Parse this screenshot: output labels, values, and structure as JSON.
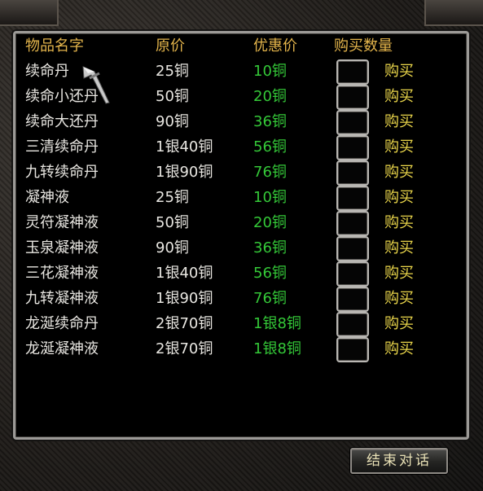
{
  "headers": {
    "name": "物品名字",
    "price": "原价",
    "discount": "优惠价",
    "quantity": "购买数量"
  },
  "items": [
    {
      "name": "续命丹",
      "price": "25铜",
      "discount": "10铜",
      "buy": "购买"
    },
    {
      "name": "续命小还丹",
      "price": "50铜",
      "discount": "20铜",
      "buy": "购买"
    },
    {
      "name": "续命大还丹",
      "price": "90铜",
      "discount": "36铜",
      "buy": "购买"
    },
    {
      "name": "三清续命丹",
      "price": "1银40铜",
      "discount": "56铜",
      "buy": "购买"
    },
    {
      "name": "九转续命丹",
      "price": "1银90铜",
      "discount": "76铜",
      "buy": "购买"
    },
    {
      "name": "凝神液",
      "price": "25铜",
      "discount": "10铜",
      "buy": "购买"
    },
    {
      "name": "灵符凝神液",
      "price": "50铜",
      "discount": "20铜",
      "buy": "购买"
    },
    {
      "name": "玉泉凝神液",
      "price": "90铜",
      "discount": "36铜",
      "buy": "购买"
    },
    {
      "name": "三花凝神液",
      "price": "1银40铜",
      "discount": "56铜",
      "buy": "购买"
    },
    {
      "name": "九转凝神液",
      "price": "1银90铜",
      "discount": "76铜",
      "buy": "购买"
    },
    {
      "name": "龙涎续命丹",
      "price": "2银70铜",
      "discount": "1银8铜",
      "buy": "购买"
    },
    {
      "name": "龙涎凝神液",
      "price": "2银70铜",
      "discount": "1银8铜",
      "buy": "购买"
    }
  ],
  "end_button": "结束对话",
  "colors": {
    "header": "#e3b44b",
    "item_text": "#e8e6e1",
    "discount": "#34c838",
    "buy": "#e9d54a"
  }
}
